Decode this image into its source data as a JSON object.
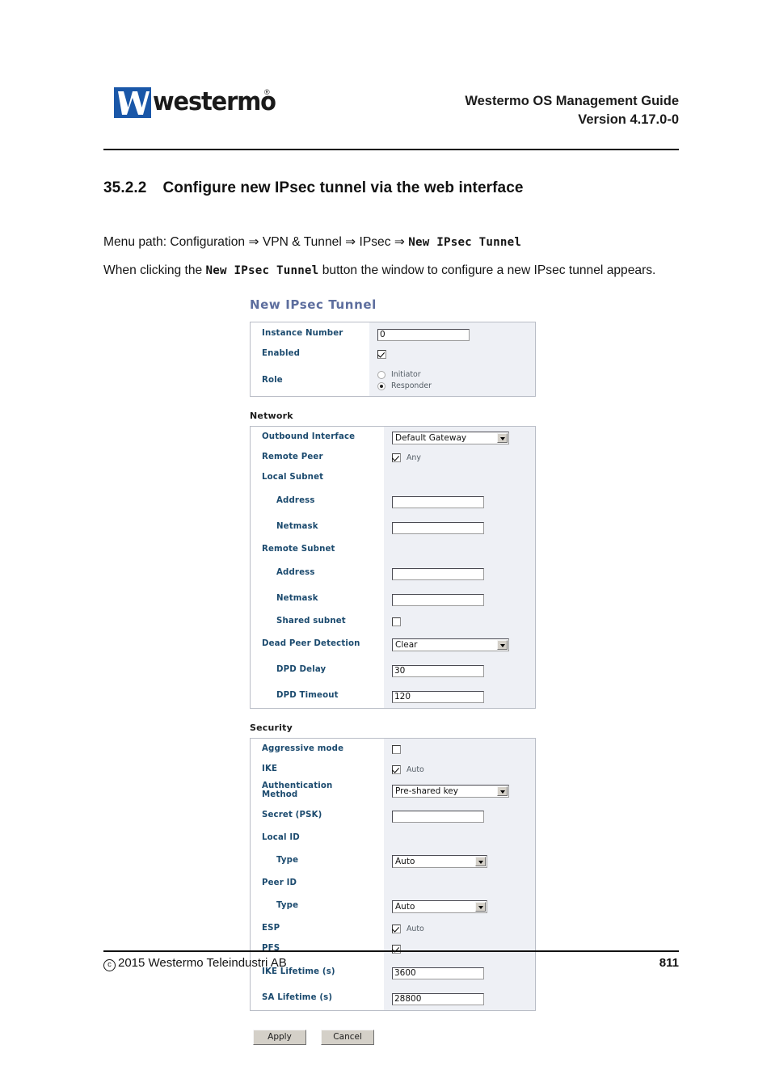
{
  "header": {
    "logo_text": "westermo",
    "logo_registered": "®",
    "doc_title": "Westermo OS Management Guide",
    "doc_version": "Version 4.17.0-0"
  },
  "content": {
    "heading_number": "35.2.2",
    "heading_text": "Configure new IPsec tunnel via the web interface",
    "menu_path_prefix": "Menu path: Configuration ⇒ VPN & Tunnel ⇒ IPsec ⇒ ",
    "menu_path_target": "New IPsec Tunnel",
    "intro_prefix": "When clicking the ",
    "intro_target": "New IPsec Tunnel",
    "intro_suffix": " button the window to configure a new IPsec tunnel appears."
  },
  "screenshot": {
    "title": "New IPsec Tunnel",
    "groups": {
      "general": {
        "rows": {
          "instance_number_label": "Instance Number",
          "instance_number_value": "0",
          "enabled_label": "Enabled",
          "enabled_checked": true,
          "role_label": "Role",
          "role_option_initiator": "Initiator",
          "role_option_responder": "Responder",
          "role_selected": "Responder"
        }
      },
      "network": {
        "title": "Network",
        "rows": {
          "outbound_interface_label": "Outbound Interface",
          "outbound_interface_value": "Default Gateway",
          "remote_peer_label": "Remote Peer",
          "remote_peer_any_label": "Any",
          "remote_peer_any_checked": true,
          "local_subnet_label": "Local Subnet",
          "local_address_label": "Address",
          "local_address_value": "",
          "local_netmask_label": "Netmask",
          "local_netmask_value": "",
          "remote_subnet_label": "Remote Subnet",
          "remote_address_label": "Address",
          "remote_address_value": "",
          "remote_netmask_label": "Netmask",
          "remote_netmask_value": "",
          "shared_subnet_label": "Shared subnet",
          "shared_subnet_checked": false,
          "dpd_label": "Dead Peer Detection",
          "dpd_value": "Clear",
          "dpd_delay_label": "DPD Delay",
          "dpd_delay_value": "30",
          "dpd_timeout_label": "DPD Timeout",
          "dpd_timeout_value": "120"
        }
      },
      "security": {
        "title": "Security",
        "rows": {
          "aggressive_mode_label": "Aggressive mode",
          "aggressive_mode_checked": false,
          "ike_label": "IKE",
          "ike_auto_label": "Auto",
          "ike_auto_checked": true,
          "auth_method_label_line1": "Authentication",
          "auth_method_label_line2": "Method",
          "auth_method_value": "Pre-shared key",
          "secret_label": "Secret (PSK)",
          "secret_value": "",
          "local_id_label": "Local ID",
          "local_id_type_label": "Type",
          "local_id_type_value": "Auto",
          "peer_id_label": "Peer ID",
          "peer_id_type_label": "Type",
          "peer_id_type_value": "Auto",
          "esp_label": "ESP",
          "esp_auto_label": "Auto",
          "esp_auto_checked": true,
          "pfs_label": "PFS",
          "pfs_checked": true,
          "ike_lifetime_label": "IKE Lifetime (s)",
          "ike_lifetime_value": "3600",
          "sa_lifetime_label": "SA Lifetime (s)",
          "sa_lifetime_value": "28800"
        }
      }
    },
    "buttons": {
      "apply": "Apply",
      "cancel": "Cancel"
    }
  },
  "footer": {
    "copyright": "2015 Westermo Teleindustri AB",
    "page_number": "811"
  },
  "colors": {
    "logo_blue": "#1a57a8",
    "panel_bg": "#eef0f5",
    "label_text": "#1b4a6e",
    "shot_title": "#5d6e9e"
  }
}
